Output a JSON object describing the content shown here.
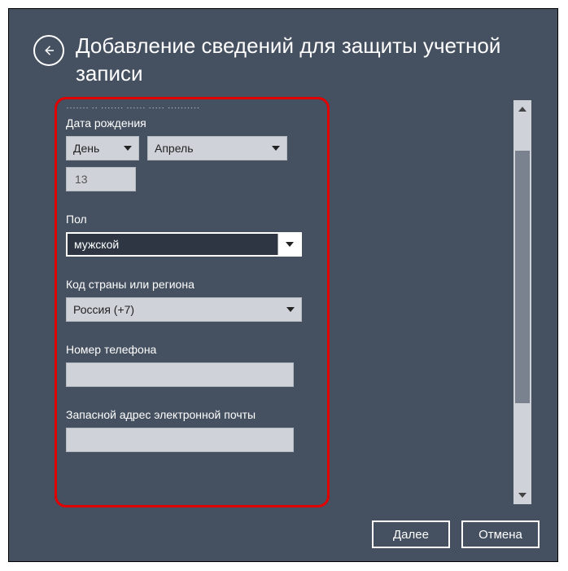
{
  "title": "Добавление сведений для защиты учетной записи",
  "cutoff_text": "······· ·· ······· ······ ····· ··········",
  "dob": {
    "label": "Дата рождения",
    "day": "День",
    "month": "Апрель",
    "year": "13"
  },
  "gender": {
    "label": "Пол",
    "value": "мужской"
  },
  "country": {
    "label": "Код страны или региона",
    "value": "Россия (+7)"
  },
  "phone": {
    "label": "Номер телефона"
  },
  "altemail": {
    "label": "Запасной адрес электронной почты"
  },
  "buttons": {
    "next": "Далее",
    "cancel": "Отмена"
  }
}
